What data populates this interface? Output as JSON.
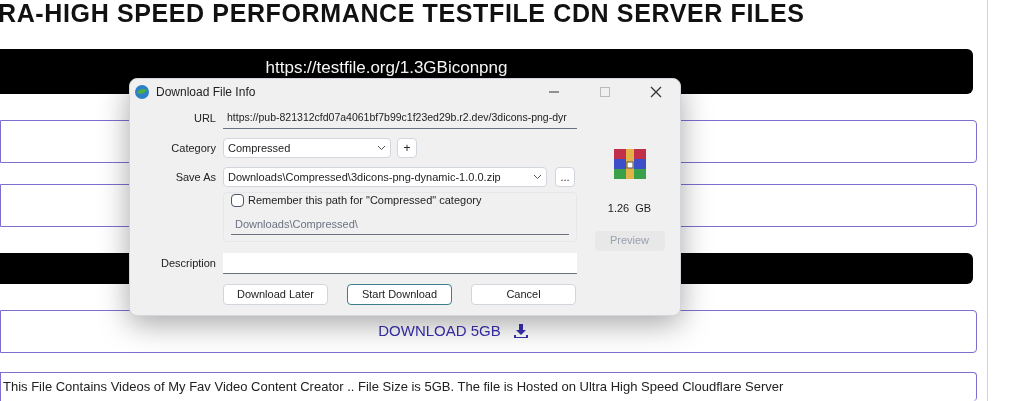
{
  "page": {
    "heading": "RA-HIGH SPEED PERFORMANCE TESTFILE CDN SERVER FILES",
    "link_bar": "https://testfile.org/1.3GBiconpng",
    "download_button": "DOWNLOAD 5GB",
    "description": "This File Contains Videos of My Fav Video Content Creator .. File Size is 5GB. The file is Hosted on Ultra High Speed Cloudflare Server"
  },
  "dialog": {
    "title": "Download File Info",
    "url": {
      "label": "URL",
      "value": "https://pub-821312cfd07a4061bf7b99c1f23ed29b.r2.dev/3dicons-png-dyr"
    },
    "category": {
      "label": "Category",
      "value": "Compressed",
      "add": "+"
    },
    "save_as": {
      "label": "Save As",
      "value": "Downloads\\Compressed\\3dicons-png-dynamic-1.0.0.zip",
      "browse": "..."
    },
    "remember": {
      "label": "Remember this path for \"Compressed\" category",
      "checked": false,
      "path": "Downloads\\Compressed\\"
    },
    "size": "1.26  GB",
    "preview": {
      "label": "Preview",
      "disabled": true
    },
    "description": {
      "label": "Description"
    },
    "buttons": [
      {
        "label": "Download Later",
        "default": false
      },
      {
        "label": "Start Download",
        "default": true
      },
      {
        "label": "Cancel",
        "default": false
      }
    ]
  }
}
